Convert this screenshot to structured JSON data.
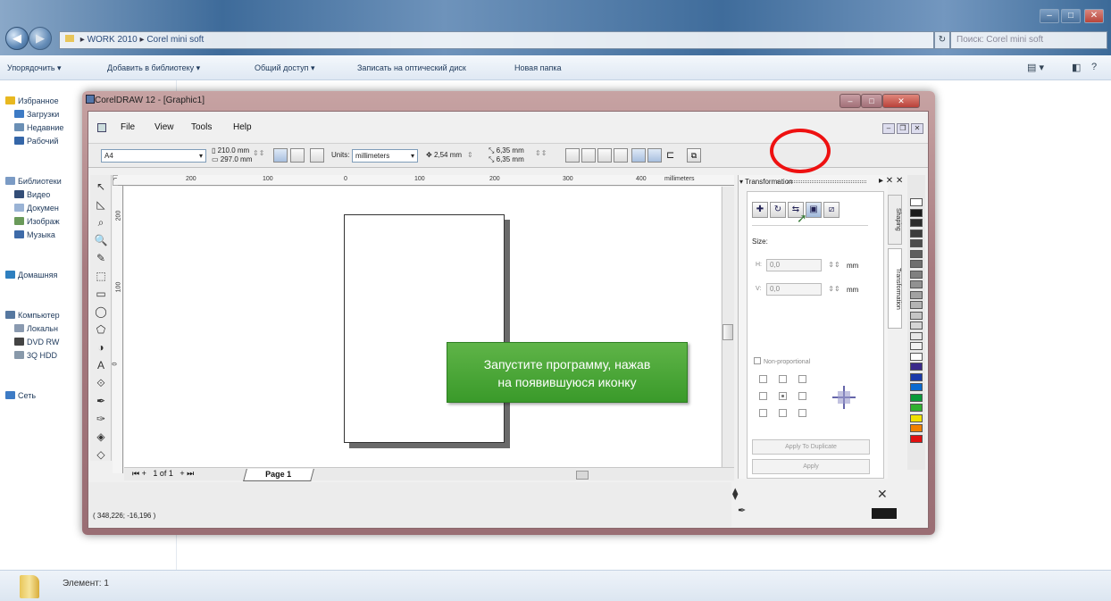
{
  "explorer": {
    "breadcrumb": [
      "WORK 2010",
      "Corel mini soft"
    ],
    "search_placeholder": "Поиск: Corel mini soft",
    "window_controls": [
      "–",
      "□",
      "✕"
    ],
    "commands": [
      "Упорядочить ▾",
      "Добавить в библиотеку ▾",
      "Общий доступ ▾",
      "Записать на оптический диск",
      "Новая папка"
    ],
    "nav_items": [
      {
        "label": "Избранное",
        "icon": "star-icon",
        "color": "#e8b820"
      },
      {
        "label": "Загрузки",
        "icon": "downloads-icon",
        "color": "#3d7bc5"
      },
      {
        "label": "Недавние",
        "icon": "recent-icon",
        "color": "#6a8fb5"
      },
      {
        "label": "Рабочий",
        "icon": "desktop-icon",
        "color": "#3566a8"
      },
      {
        "label": "Библиотеки",
        "icon": "library-icon",
        "color": "#7b9bc5"
      },
      {
        "label": "Видео",
        "icon": "video-icon",
        "color": "#334d77"
      },
      {
        "label": "Докумен",
        "icon": "documents-icon",
        "color": "#9ab3d5"
      },
      {
        "label": "Изображ",
        "icon": "pictures-icon",
        "color": "#6a9a5a"
      },
      {
        "label": "Музыка",
        "icon": "music-icon",
        "color": "#3d6aa8"
      },
      {
        "label": "Домашняя",
        "icon": "homegroup-icon",
        "color": "#2e7fbf"
      },
      {
        "label": "Компьютер",
        "icon": "computer-icon",
        "color": "#5678a0"
      },
      {
        "label": "Локальн",
        "icon": "drive-icon",
        "color": "#8a9ab0"
      },
      {
        "label": "DVD RW",
        "icon": "dvd-icon",
        "color": "#444444"
      },
      {
        "label": "3Q HDD",
        "icon": "hdd-icon",
        "color": "#8899aa"
      },
      {
        "label": "Сеть",
        "icon": "network-icon",
        "color": "#3d7bc5"
      }
    ],
    "status": "Элемент: 1"
  },
  "corel": {
    "title": "CorelDRAW 12 - [Graphic1]",
    "menu": [
      "File",
      "View",
      "Tools",
      "Help"
    ],
    "propbar": {
      "paper": "A4",
      "width": "210.0 mm",
      "height": "297.0 mm",
      "units_label": "Units:",
      "units": "millimeters",
      "nudge": "2,54 mm",
      "dup_x": "6,35 mm",
      "dup_y": "6,35 mm"
    },
    "ruler_h": [
      "200",
      "100",
      "0",
      "100",
      "200",
      "300",
      "400"
    ],
    "ruler_unit": "millimeters",
    "ruler_v": [
      "200",
      "100",
      "0"
    ],
    "page_nav": "1 of 1",
    "page_tab": "Page 1",
    "coords": "( 348,226; -16,196 )",
    "docker": {
      "title": "Transformation",
      "size_label": "Size:",
      "h_label": "H:",
      "v_label": "V:",
      "h_value": "0,0",
      "v_value": "0,0",
      "unit": "mm",
      "non_proportional": "Non-proportional",
      "apply_dup": "Apply To Duplicate",
      "apply": "Apply",
      "tabs": [
        "Shaping",
        "Transformation"
      ]
    },
    "palette": [
      "#ffffff",
      "#1a1a1a",
      "#2b2b2b",
      "#3c3c3c",
      "#4d4d4d",
      "#5e5e5e",
      "#6f6f6f",
      "#808080",
      "#919191",
      "#a2a2a2",
      "#b3b3b3",
      "#c4c4c4",
      "#d5d5d5",
      "#e6e6e6",
      "#f2f2f2",
      "#ffffff",
      "#3a2a8a",
      "#1a3aaa",
      "#0a6ad0",
      "#0a9a3a",
      "#30b030",
      "#f0e000",
      "#f08000",
      "#e01010"
    ]
  },
  "callout": {
    "line1": "Запустите программу, нажав",
    "line2": "на появившуюся иконку",
    "color": "#4aa838"
  },
  "highlight_color": "#e11111"
}
